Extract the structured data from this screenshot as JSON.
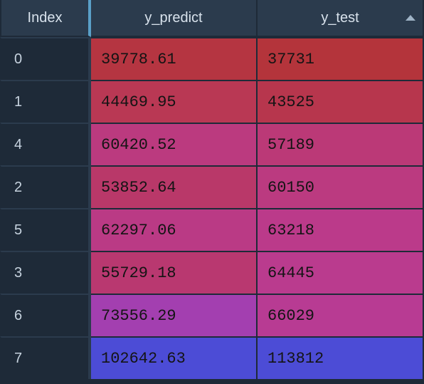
{
  "headers": {
    "index": "Index",
    "y_predict": "y_predict",
    "y_test": "y_test"
  },
  "sort": {
    "column": "y_test",
    "direction": "asc"
  },
  "rows": [
    {
      "index": "0",
      "y_predict": "39778.61",
      "y_test": "37731"
    },
    {
      "index": "1",
      "y_predict": "44469.95",
      "y_test": "43525"
    },
    {
      "index": "4",
      "y_predict": "60420.52",
      "y_test": "57189"
    },
    {
      "index": "2",
      "y_predict": "53852.64",
      "y_test": "60150"
    },
    {
      "index": "5",
      "y_predict": "62297.06",
      "y_test": "63218"
    },
    {
      "index": "3",
      "y_predict": "55729.18",
      "y_test": "64445"
    },
    {
      "index": "6",
      "y_predict": "73556.29",
      "y_test": "66029"
    },
    {
      "index": "7",
      "y_predict": "102642.63",
      "y_test": "113812"
    }
  ],
  "chart_data": {
    "type": "table",
    "title": "",
    "columns": [
      "Index",
      "y_predict",
      "y_test"
    ],
    "index": [
      0,
      1,
      4,
      2,
      5,
      3,
      6,
      7
    ],
    "y_predict": [
      39778.61,
      44469.95,
      60420.52,
      53852.64,
      62297.06,
      55729.18,
      73556.29,
      102642.63
    ],
    "y_test": [
      37731,
      43525,
      57189,
      60150,
      63218,
      64445,
      66029,
      113812
    ],
    "sort_by": "y_test",
    "sort_dir": "ascending",
    "heatmap": true
  }
}
